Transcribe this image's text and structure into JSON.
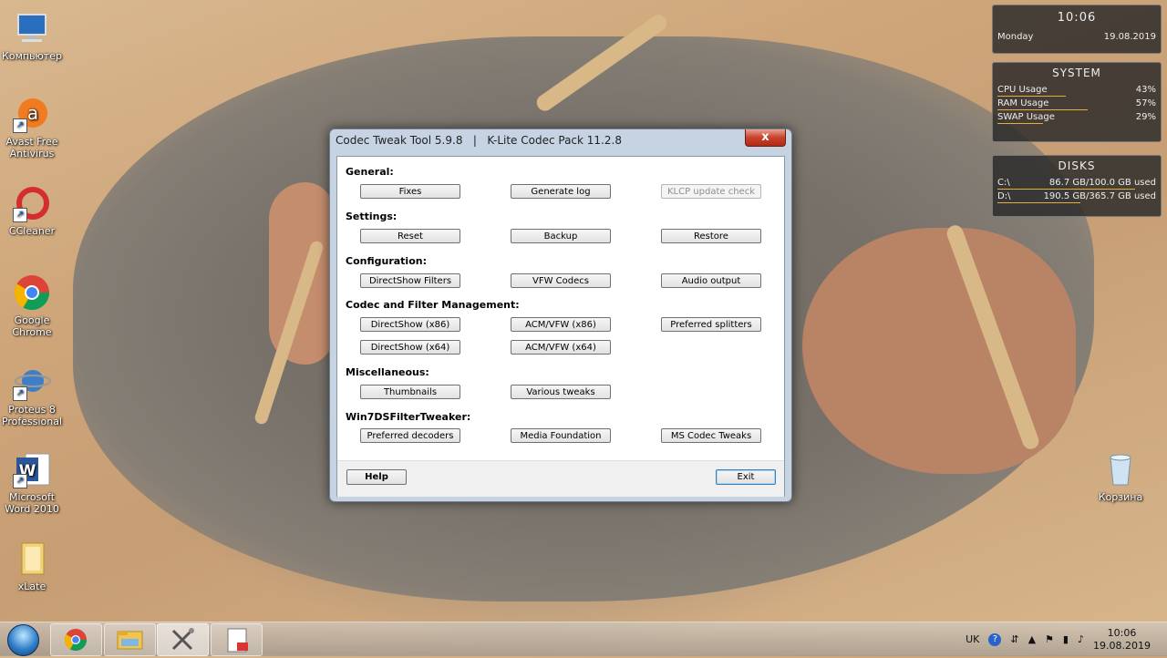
{
  "desktop_icons": [
    {
      "label": "Компьютер",
      "icon": "computer-icon"
    },
    {
      "label": "Avast Free Antivirus",
      "icon": "avast-icon"
    },
    {
      "label": "CCleaner",
      "icon": "ccleaner-icon"
    },
    {
      "label": "Google Chrome",
      "icon": "chrome-icon"
    },
    {
      "label": "Proteus 8 Professional",
      "icon": "proteus-icon"
    },
    {
      "label": "Microsoft Word 2010",
      "icon": "word-icon"
    },
    {
      "label": "xLate",
      "icon": "folder-icon"
    },
    {
      "label": "Корзина",
      "icon": "recycle-bin-icon"
    }
  ],
  "gadgets": {
    "clock": {
      "time": "10:06",
      "day": "Monday",
      "date": "19.08.2019"
    },
    "system": {
      "title": "SYSTEM",
      "rows": [
        {
          "label": "CPU Usage",
          "value": "43%",
          "fraction": 0.43
        },
        {
          "label": "RAM Usage",
          "value": "57%",
          "fraction": 0.57
        },
        {
          "label": "SWAP Usage",
          "value": "29%",
          "fraction": 0.29
        }
      ]
    },
    "disks": {
      "title": "DISKS",
      "rows": [
        {
          "label": "C:\\",
          "value": "86.7 GB/100.0 GB used",
          "fraction": 0.867
        },
        {
          "label": "D:\\",
          "value": "190.5 GB/365.7 GB used",
          "fraction": 0.521
        }
      ]
    }
  },
  "window": {
    "title": "Codec Tweak Tool 5.9.8   |   K-Lite Codec Pack 11.2.8",
    "close_label": "x",
    "sections": {
      "general": "General:",
      "settings": "Settings:",
      "configuration": "Configuration:",
      "codec": "Codec and Filter Management:",
      "misc": "Miscellaneous:",
      "win7": "Win7DSFilterTweaker:"
    },
    "buttons": {
      "fixes": "Fixes",
      "generate_log": "Generate log",
      "klcp_update": "KLCP update check",
      "reset": "Reset",
      "backup": "Backup",
      "restore": "Restore",
      "directshow_filters": "DirectShow Filters",
      "vfw_codecs": "VFW Codecs",
      "audio_output": "Audio output",
      "directshow_x86": "DirectShow  (x86)",
      "acm_vfw_x86": "ACM/VFW  (x86)",
      "preferred_splitters": "Preferred splitters",
      "directshow_x64": "DirectShow  (x64)",
      "acm_vfw_x64": "ACM/VFW  (x64)",
      "thumbnails": "Thumbnails",
      "various_tweaks": "Various tweaks",
      "preferred_decoders": "Preferred decoders",
      "media_foundation": "Media Foundation",
      "ms_codec_tweaks": "MS Codec Tweaks",
      "help": "Help",
      "exit": "Exit"
    }
  },
  "taskbar": {
    "items": [
      "chrome-icon",
      "explorer-icon",
      "tools-icon",
      "document-icon"
    ],
    "tray": {
      "lang": "UK",
      "time": "10:06",
      "date": "19.08.2019"
    }
  }
}
